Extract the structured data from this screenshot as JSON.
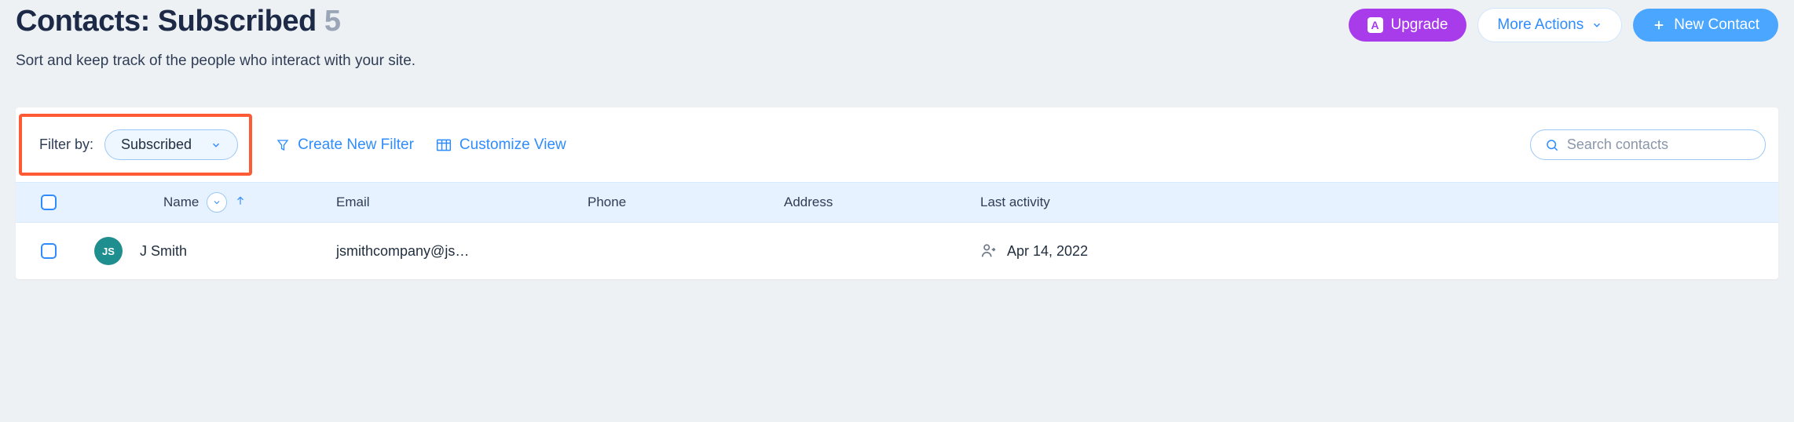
{
  "header": {
    "title_prefix": "Contacts: ",
    "title_filter": "Subscribed",
    "count": "5",
    "subtitle": "Sort and keep track of the people who interact with your site.",
    "upgrade_label": "Upgrade",
    "more_actions_label": "More Actions",
    "new_contact_label": "New Contact"
  },
  "toolbar": {
    "filter_by_label": "Filter by:",
    "filter_value": "Subscribed",
    "create_filter_label": "Create New Filter",
    "customize_view_label": "Customize View",
    "search_placeholder": "Search contacts"
  },
  "table": {
    "columns": {
      "name": "Name",
      "email": "Email",
      "phone": "Phone",
      "address": "Address",
      "last_activity": "Last activity"
    },
    "rows": [
      {
        "avatar_initials": "JS",
        "name": "J Smith",
        "email": "jsmithcompany@js…",
        "phone": "",
        "address": "",
        "last_activity": "Apr 14, 2022"
      }
    ]
  }
}
